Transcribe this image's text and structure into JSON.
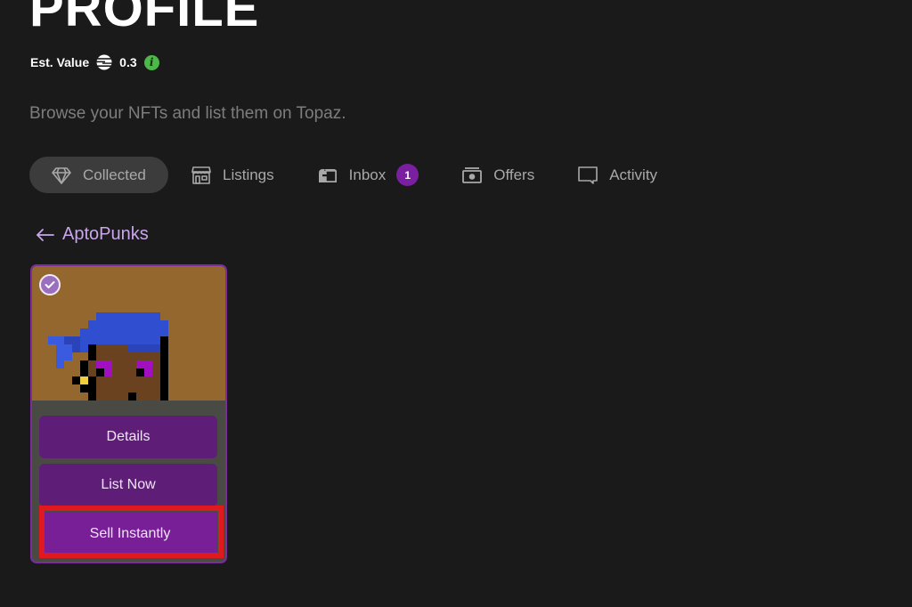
{
  "header": {
    "title": "PROFILE",
    "est_value_label": "Est. Value",
    "est_value_currency_icon": "aptos-coin-icon",
    "est_value_amount": "0.3",
    "info_icon": "info-icon",
    "subtitle": "Browse your NFTs and list them on Topaz."
  },
  "tabs": [
    {
      "label": "Collected",
      "icon": "diamond-icon",
      "active": true
    },
    {
      "label": "Listings",
      "icon": "storefront-icon",
      "active": false
    },
    {
      "label": "Inbox",
      "icon": "mailbox-icon",
      "active": false,
      "badge": "1"
    },
    {
      "label": "Offers",
      "icon": "cash-icon",
      "active": false
    },
    {
      "label": "Activity",
      "icon": "chat-bubble-icon",
      "active": false
    }
  ],
  "collection": {
    "back_icon": "arrow-left-icon",
    "name": "AptoPunks"
  },
  "card": {
    "selected": true,
    "buttons": {
      "details": "Details",
      "list_now": "List Now",
      "sell_instantly": "Sell Instantly"
    },
    "highlighted_button": "sell_instantly"
  },
  "colors": {
    "background": "#1a1a1a",
    "accent_purple": "#7a1fa0",
    "link_lavender": "#c9a6ec",
    "info_green": "#4cb848",
    "annotation_red": "#e0191f",
    "nft_background": "#94672f"
  }
}
